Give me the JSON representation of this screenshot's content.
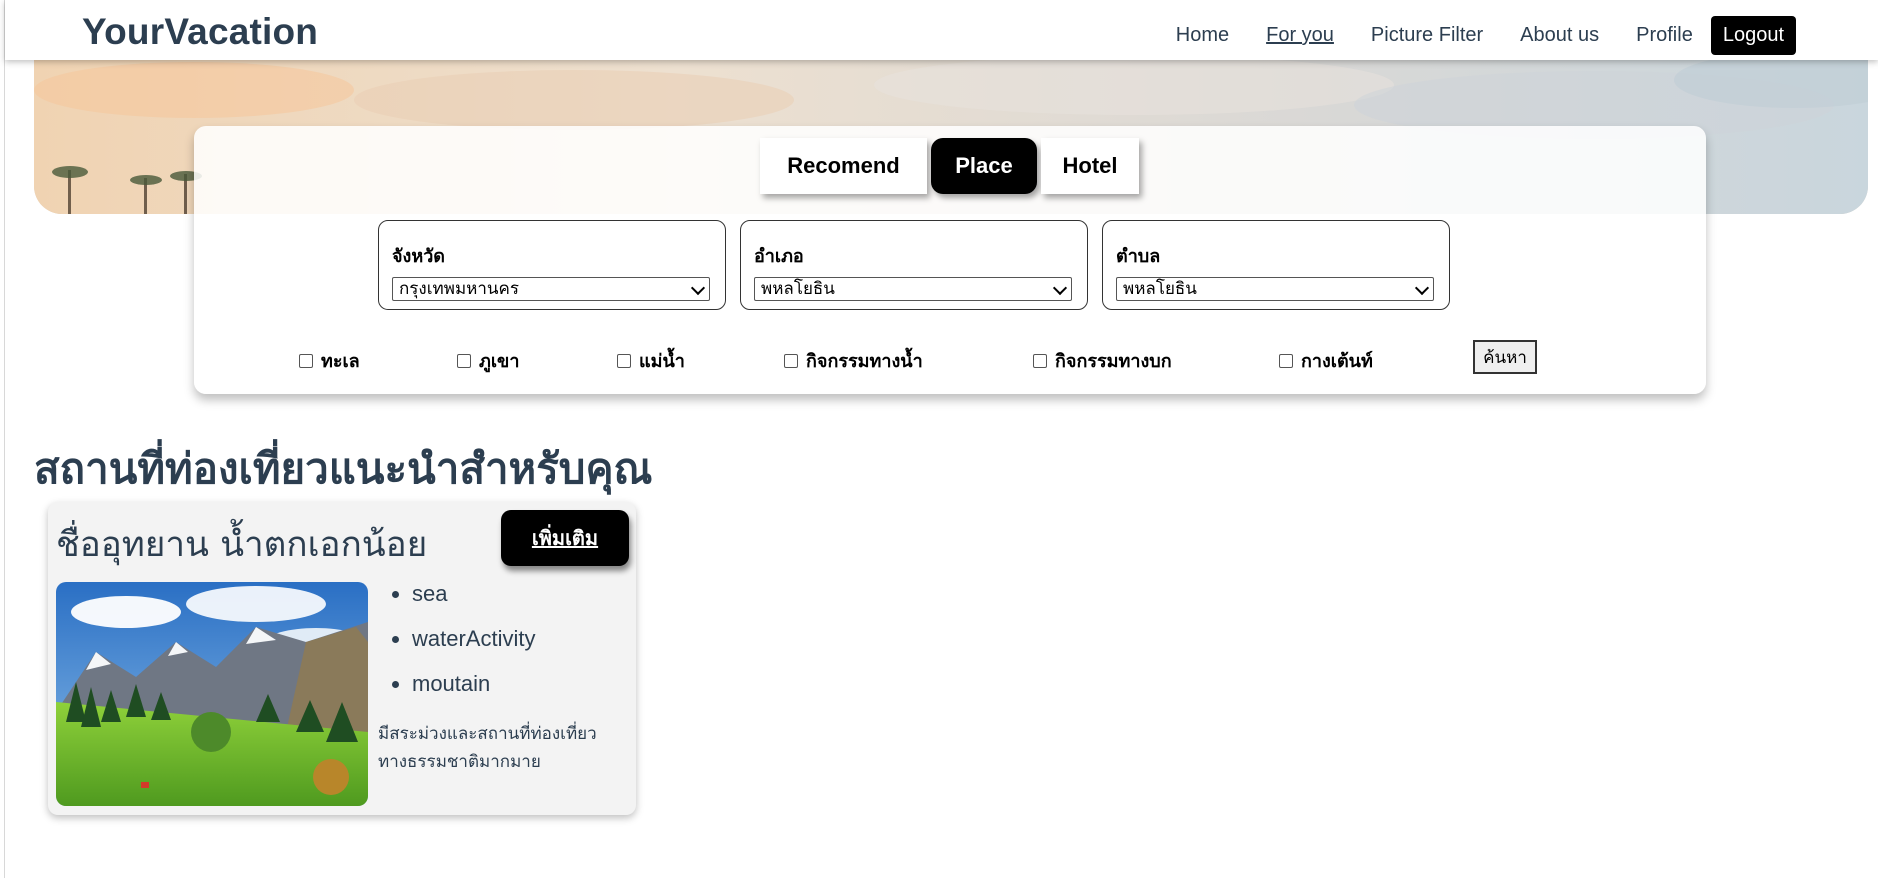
{
  "navbar": {
    "brand": "YourVacation",
    "links": [
      "Home",
      "For you",
      "Picture Filter",
      "About us",
      "Profile"
    ],
    "logout": "Logout"
  },
  "tabs": [
    "Recomend",
    "Place",
    "Hotel"
  ],
  "filters": [
    {
      "label": "จังหวัด",
      "value": "กรุงเทพมหานคร"
    },
    {
      "label": "อำเภอ",
      "value": "พหลโยธิน"
    },
    {
      "label": "ตำบล",
      "value": "พหลโยธิน"
    }
  ],
  "checkboxes": [
    "ทะเล",
    "ภูเขา",
    "แม่น้ำ",
    "กิจกรรมทางน้ำ",
    "กิจกรรมทางบก",
    "กางเต้นท์"
  ],
  "search_button": "ค้นหา",
  "section": {
    "title": "สถานที่ท่องเที่ยวแนะนำสำหรับคุณ"
  },
  "card": {
    "title": "ชื่ออุทยาน น้ำตกเอกน้อย",
    "more_button": "เพิ่มเติม",
    "tags": [
      "sea",
      "waterActivity",
      "moutain"
    ],
    "description_line1": "มีสระม่วงและสถานที่ท่องเที่ยว",
    "description_line2": "ทางธรรมชาติมากมาย"
  },
  "colors": {
    "text": "#2c3e50",
    "button": "#000000"
  },
  "icons": [
    "chevron-down-icon",
    "checkbox-icon"
  ]
}
